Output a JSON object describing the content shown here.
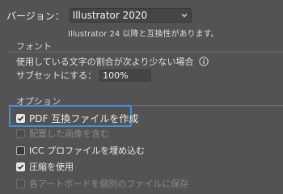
{
  "version": {
    "label": "バージョン：",
    "selected": "Illustrator 2020",
    "compat_note": "Illustrator 24 以降と互換性があります。"
  },
  "fonts": {
    "header": "フォント",
    "description": "使用している文字の割合が次より少ない場合",
    "subset_label": "サブセットにする：",
    "subset_value": "100%"
  },
  "options": {
    "header": "オプション",
    "items": [
      {
        "label": "PDF 互換ファイルを作成",
        "checked": true,
        "enabled": true
      },
      {
        "label": "配置した画像を含む",
        "checked": false,
        "enabled": false
      },
      {
        "label": "ICC プロファイルを埋め込む",
        "checked": false,
        "enabled": true
      },
      {
        "label": "圧縮を使用",
        "checked": true,
        "enabled": true
      },
      {
        "label": "各アートボードを個別のファイルに保存",
        "checked": false,
        "enabled": false
      }
    ]
  },
  "colors": {
    "background": "#535353",
    "focus_ring": "#3f8fdc"
  },
  "icons": {
    "dropdown": "chevron-down-icon",
    "info": "info-icon",
    "check": "checkmark-icon"
  }
}
